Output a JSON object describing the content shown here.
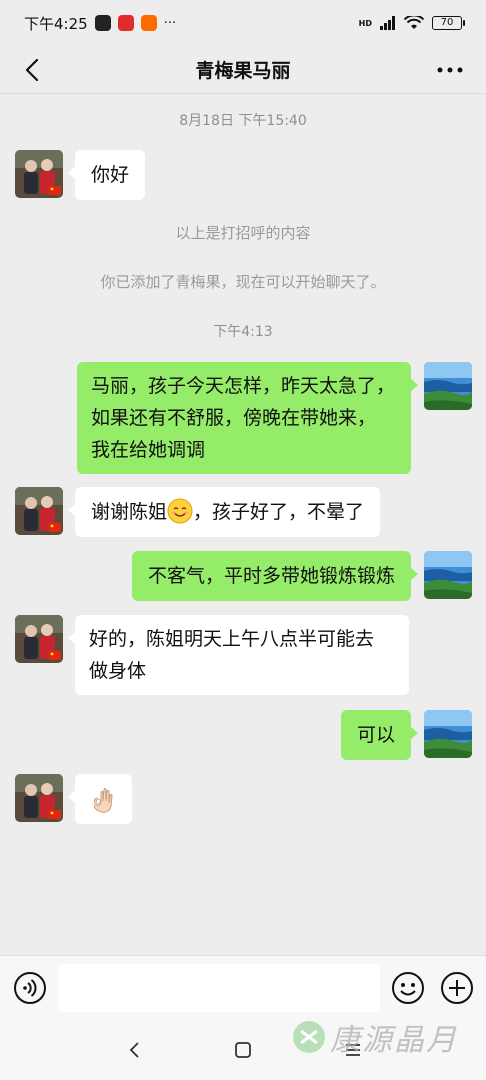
{
  "status_bar": {
    "time": "下午4:25",
    "more_dots": "···",
    "network": "HD",
    "battery": "70"
  },
  "header": {
    "title": "青梅果马丽"
  },
  "chat": {
    "timestamps": [
      "8月18日 下午15:40",
      "下午4:13"
    ],
    "system_messages": [
      "以上是打招呼的内容",
      "你已添加了青梅果，现在可以开始聊天了。"
    ],
    "messages": [
      {
        "sender": "contact",
        "text": "你好"
      },
      {
        "sender": "me",
        "lines": [
          "马丽，孩子今天怎样，昨天太急了，",
          "如果还有不舒服，傍晚在带她来，",
          "我在给她调调"
        ]
      },
      {
        "sender": "contact",
        "text_before": "谢谢陈姐",
        "emoji": "smiling-face",
        "text_after": "，孩子好了，不晕了"
      },
      {
        "sender": "me",
        "text": "不客气，平时多带她锻炼锻炼"
      },
      {
        "sender": "contact",
        "lines": [
          "好的，陈姐明天上午八点半可能去",
          "做身体"
        ]
      },
      {
        "sender": "me",
        "text": "可以"
      },
      {
        "sender": "contact",
        "emoji": "ok-hand"
      }
    ]
  },
  "input_bar": {
    "placeholder": ""
  },
  "watermark": {
    "text": "康源晶月"
  },
  "colors": {
    "background": "#ededed",
    "my_bubble": "#95ec69",
    "contact_bubble": "#ffffff"
  }
}
